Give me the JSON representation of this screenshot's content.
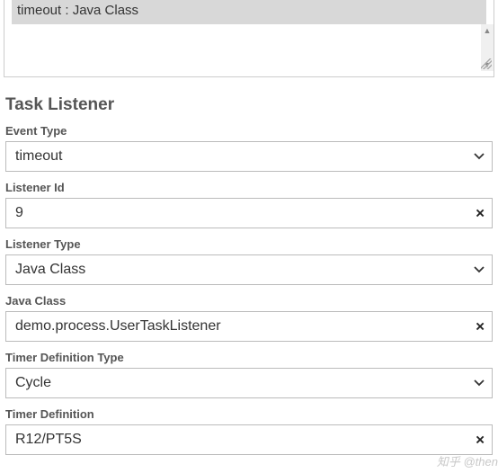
{
  "top": {
    "text": "timeout : Java Class"
  },
  "section_title": "Task Listener",
  "fields": {
    "event_type": {
      "label": "Event Type",
      "value": "timeout"
    },
    "listener_id": {
      "label": "Listener Id",
      "value": "9"
    },
    "listener_type": {
      "label": "Listener Type",
      "value": "Java Class"
    },
    "java_class": {
      "label": "Java Class",
      "value": "demo.process.UserTaskListener"
    },
    "timer_def_type": {
      "label": "Timer Definition Type",
      "value": "Cycle"
    },
    "timer_def": {
      "label": "Timer Definition",
      "value": "R12/PT5S"
    }
  },
  "watermark": "知乎 @then"
}
